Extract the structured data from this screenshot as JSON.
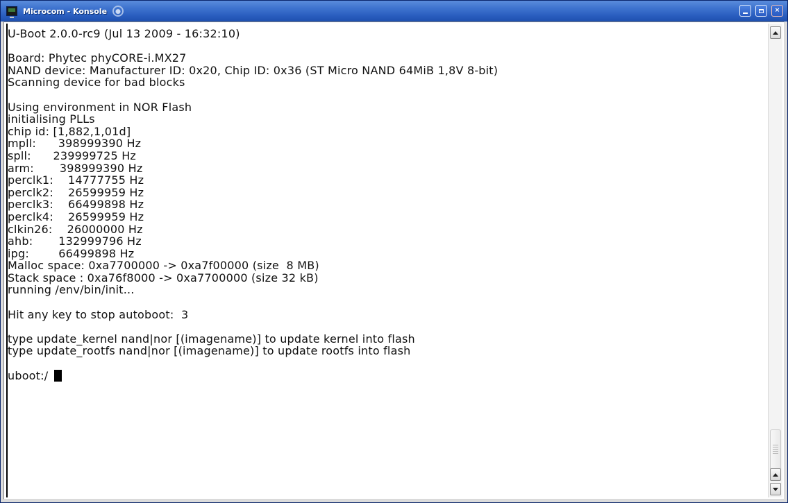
{
  "window": {
    "title": "Microcom - Konsole",
    "icon": "terminal-app-icon",
    "activity_icon": "activity-spinner-icon",
    "buttons": {
      "minimize": "minimize-icon",
      "maximize": "maximize-icon",
      "close": "close-icon",
      "close_glyph": "×"
    }
  },
  "terminal": {
    "lines": [
      "U-Boot 2.0.0-rc9 (Jul 13 2009 - 16:32:10)",
      "",
      "Board: Phytec phyCORE-i.MX27",
      "NAND device: Manufacturer ID: 0x20, Chip ID: 0x36 (ST Micro NAND 64MiB 1,8V 8-bit)",
      "Scanning device for bad blocks",
      "",
      "Using environment in NOR Flash",
      "initialising PLLs",
      "chip id: [1,882,1,01d]",
      "mpll:      398999390 Hz",
      "spll:      239999725 Hz",
      "arm:       398999390 Hz",
      "perclk1:    14777755 Hz",
      "perclk2:    26599959 Hz",
      "perclk3:    66499898 Hz",
      "perclk4:    26599959 Hz",
      "clkin26:    26000000 Hz",
      "ahb:       132999796 Hz",
      "ipg:        66499898 Hz",
      "Malloc space: 0xa7700000 -> 0xa7f00000 (size  8 MB)",
      "Stack space : 0xa76f8000 -> 0xa7700000 (size 32 kB)",
      "running /env/bin/init...",
      "",
      "Hit any key to stop autoboot:  3",
      "",
      "type update_kernel nand|nor [(imagename)] to update kernel into flash",
      "type update_rootfs nand|nor [(imagename)] to update rootfs into flash",
      ""
    ],
    "prompt": "uboot:/ "
  },
  "colors": {
    "titlebar": "#2b5fc0",
    "terminal_bg": "#ffffff",
    "terminal_fg": "#111111"
  }
}
